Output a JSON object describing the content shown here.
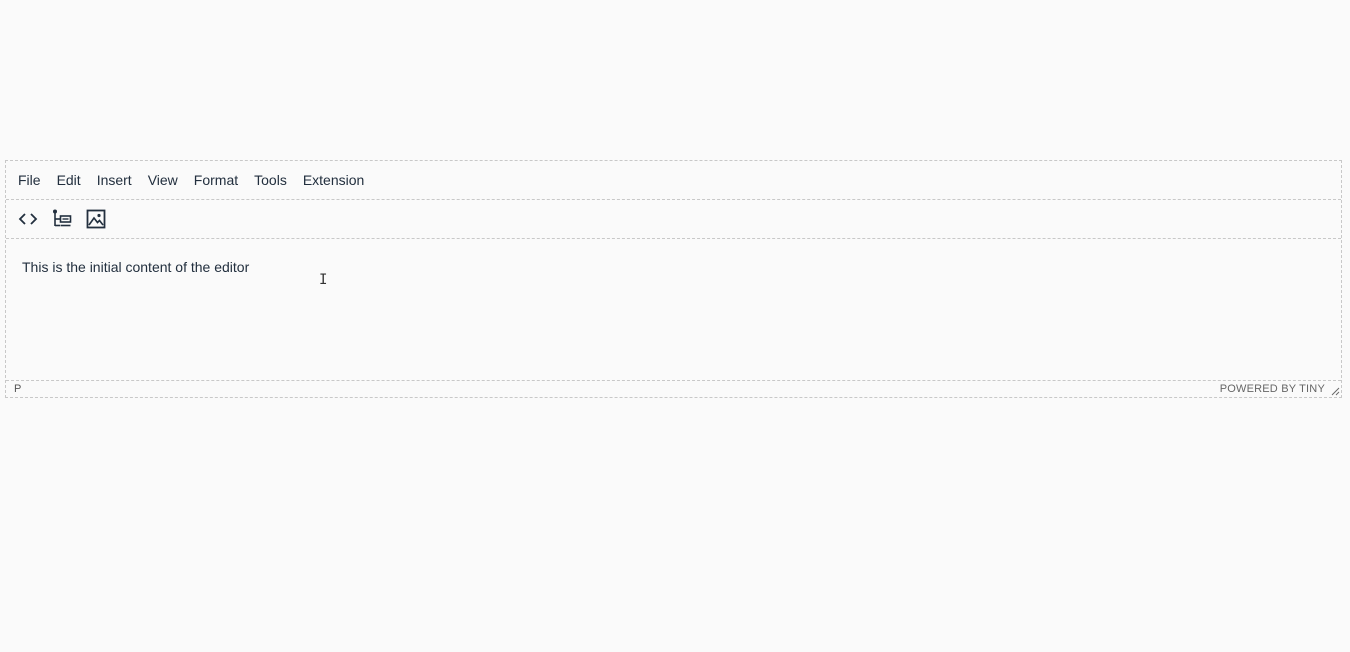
{
  "menubar": {
    "items": [
      "File",
      "Edit",
      "Insert",
      "View",
      "Format",
      "Tools",
      "Extension"
    ]
  },
  "toolbar": {
    "buttons": [
      {
        "icon": "source-code-icon"
      },
      {
        "icon": "tree-list-icon"
      },
      {
        "icon": "image-icon"
      }
    ]
  },
  "content": {
    "text": "This is the initial content of the editor"
  },
  "statusbar": {
    "path": "P",
    "branding": "POWERED BY TINY"
  },
  "colors": {
    "text": "#222f3e",
    "border": "#c8c8c8",
    "background": "#fafafa"
  }
}
